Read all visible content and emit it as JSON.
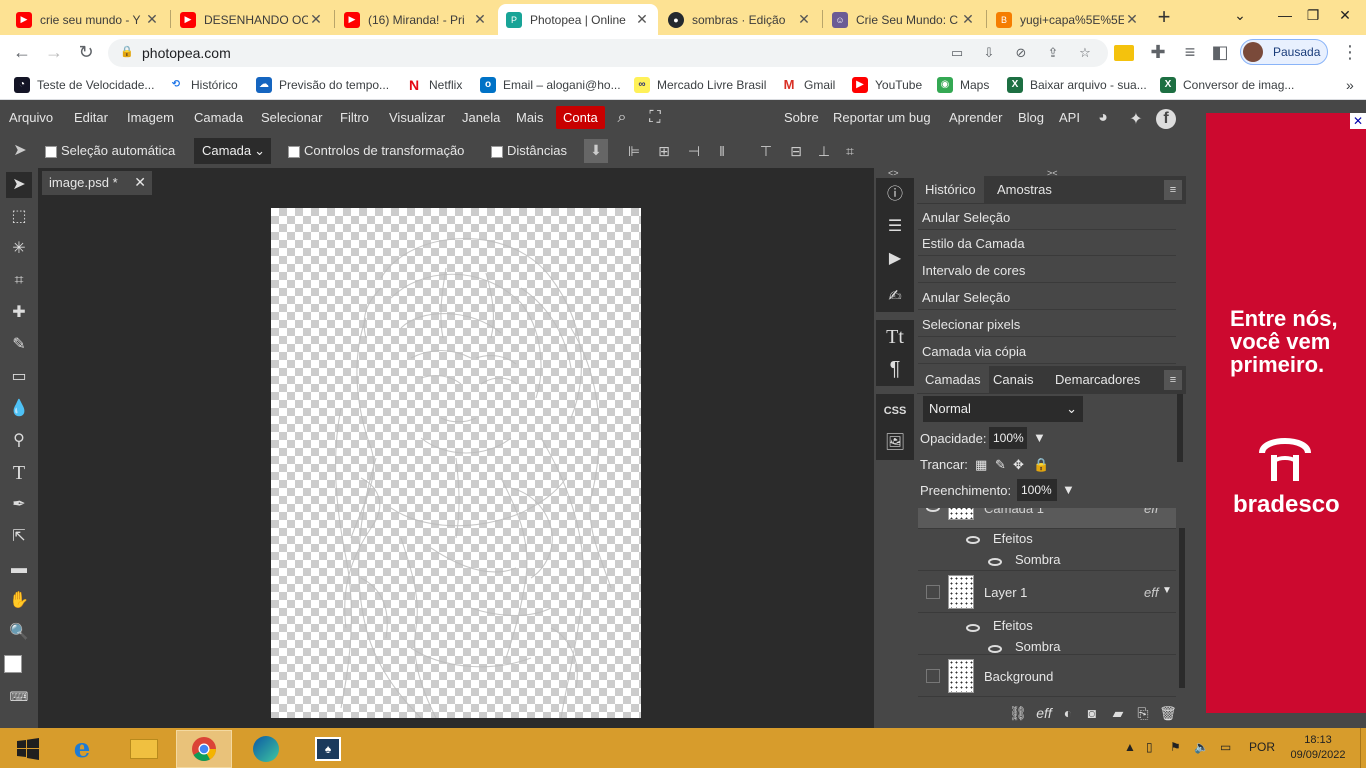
{
  "browser": {
    "tabs": [
      {
        "title": "crie seu mundo - Y",
        "icon": "youtube-icon",
        "color": "#ff0000"
      },
      {
        "title": "DESENHANDO OC",
        "icon": "youtube-icon",
        "color": "#ff0000"
      },
      {
        "title": "(16) Miranda! - Pri",
        "icon": "youtube-icon",
        "color": "#ff0000"
      },
      {
        "title": "Photopea | Online",
        "icon": "photopea-icon",
        "color": "#18a497",
        "active": true
      },
      {
        "title": "sombras · Edição",
        "icon": "github-icon",
        "color": "#24292f"
      },
      {
        "title": "Crie Seu Mundo: C",
        "icon": "anime-avatar-icon",
        "color": "#6b5b95"
      },
      {
        "title": "yugi+capa%5E%5E",
        "icon": "blogger-icon",
        "color": "#f57d00"
      }
    ],
    "new_tab": "+",
    "url": "photopea.com",
    "profile_label": "Pausada",
    "bookmarks": [
      {
        "label": "Teste de Velocidade...",
        "icon": "speedtest-icon",
        "color": "#141526"
      },
      {
        "label": "Histórico",
        "icon": "history-icon",
        "color": "#1a73e8"
      },
      {
        "label": "Previsão do tempo...",
        "icon": "weather-icon",
        "color": "#1565c0"
      },
      {
        "label": "Netflix",
        "icon": "netflix-icon",
        "color": "#e50914"
      },
      {
        "label": "Email – alogani@ho...",
        "icon": "outlook-icon",
        "color": "#0072c6"
      },
      {
        "label": "Mercado Livre Brasil",
        "icon": "mercadolivre-icon",
        "color": "#fff159"
      },
      {
        "label": "Gmail",
        "icon": "gmail-icon",
        "color": "#d93025"
      },
      {
        "label": "YouTube",
        "icon": "youtube-icon",
        "color": "#ff0000"
      },
      {
        "label": "Maps",
        "icon": "maps-icon",
        "color": "#34a853"
      },
      {
        "label": "Baixar arquivo - sua...",
        "icon": "excel-icon",
        "color": "#1d6f42"
      },
      {
        "label": "Conversor de imag...",
        "icon": "excel-icon",
        "color": "#1d6f42"
      }
    ]
  },
  "photopea": {
    "menu": [
      "Arquivo",
      "Editar",
      "Imagem",
      "Camada",
      "Selecionar",
      "Filtro",
      "Visualizar",
      "Janela",
      "Mais"
    ],
    "account_button": "Conta",
    "menu_right": [
      "Sobre",
      "Reportar um bug",
      "Aprender",
      "Blog",
      "API"
    ],
    "options": {
      "auto_select": "Seleção automática",
      "layer_select": "Camada",
      "transform_controls": "Controlos de transformação",
      "distances": "Distâncias"
    },
    "document_tab": "image.psd *",
    "history_panel": {
      "tabs": [
        "Histórico",
        "Amostras"
      ],
      "items": [
        "Anular Seleção",
        "Estilo da Camada",
        "Intervalo de cores",
        "Anular Seleção",
        "Selecionar pixels",
        "Camada via cópia"
      ]
    },
    "layers_panel": {
      "tabs": [
        "Camadas",
        "Canais",
        "Demarcadores"
      ],
      "blend_mode": "Normal",
      "opacity_label": "Opacidade:",
      "opacity": "100%",
      "lock_label": "Trancar:",
      "fill_label": "Preenchimento:",
      "fill": "100%",
      "layers": [
        {
          "name": "Camada 1",
          "eff": "eff",
          "effects_label": "Efeitos",
          "effect": "Sombra"
        },
        {
          "name": "Layer 1",
          "eff": "eff",
          "effects_label": "Efeitos",
          "effect": "Sombra"
        },
        {
          "name": "Background"
        }
      ],
      "footer_eff": "eff"
    }
  },
  "ad": {
    "headline": "Entre nós, você vem primeiro.",
    "brand": "bradesco",
    "color": "#cc092f"
  },
  "taskbar": {
    "language": "POR",
    "time": "18:13",
    "date": "09/09/2022"
  }
}
